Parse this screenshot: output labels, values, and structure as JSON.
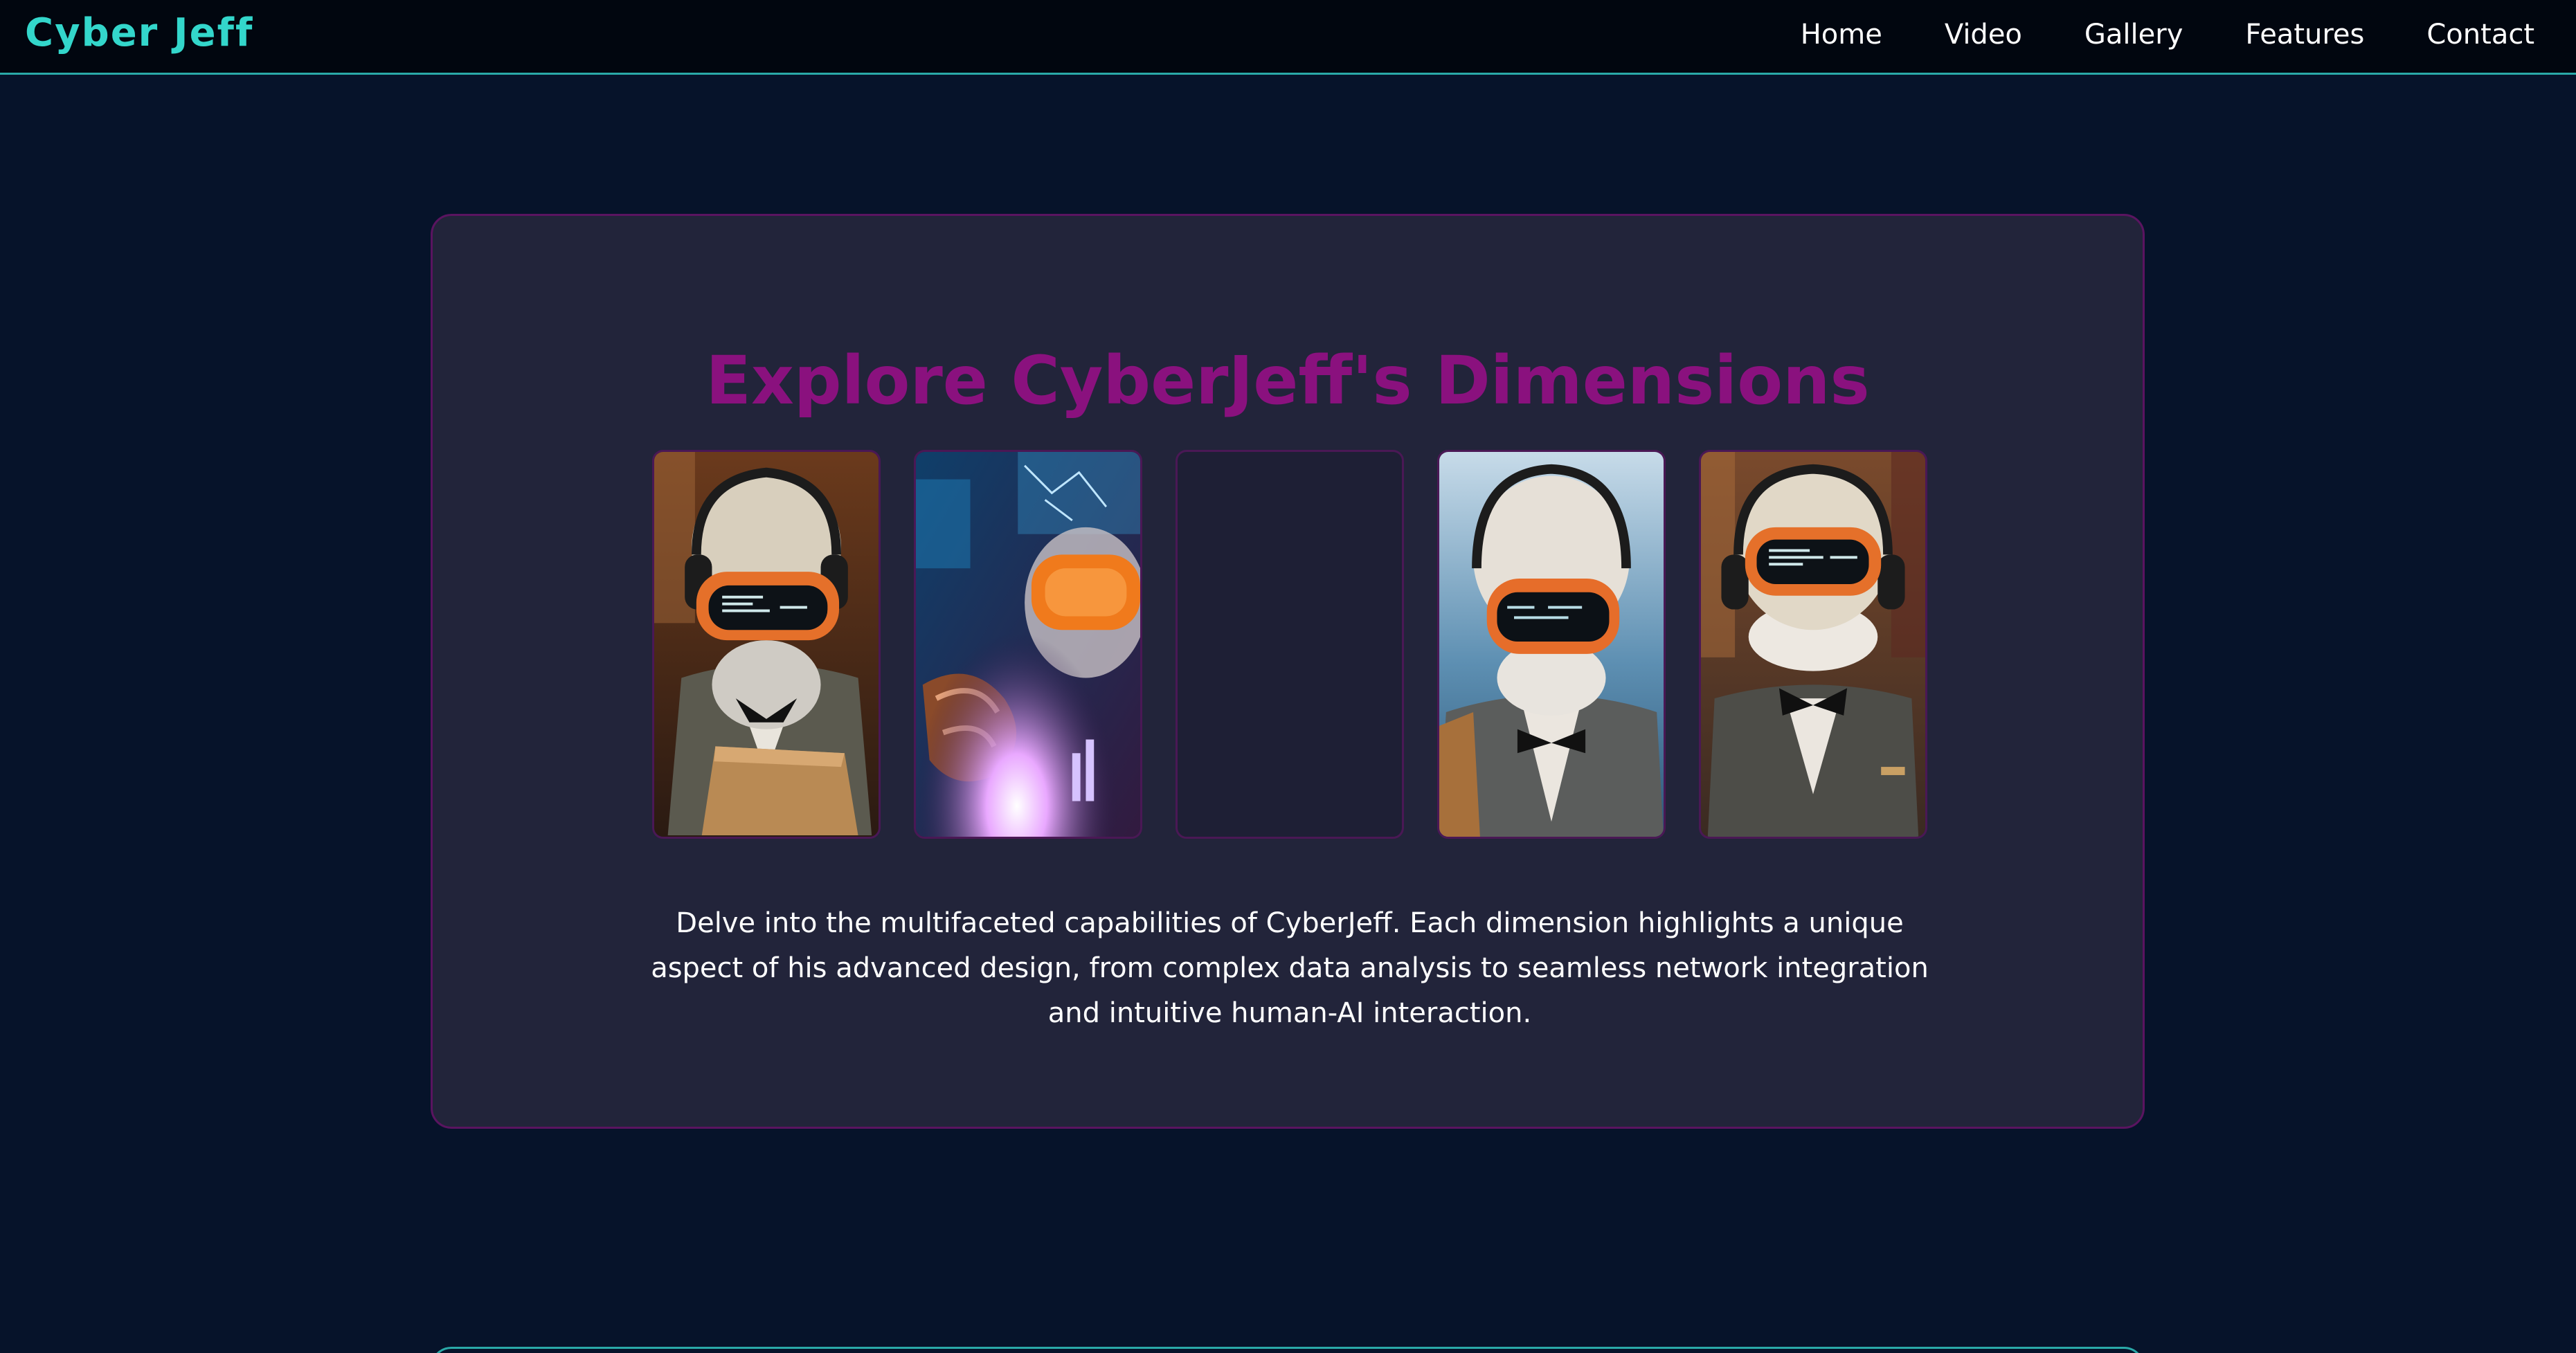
{
  "header": {
    "logo": "Cyber Jeff",
    "nav": [
      "Home",
      "Video",
      "Gallery",
      "Features",
      "Contact"
    ]
  },
  "dimensions": {
    "title": "Explore CyberJeff's Dimensions",
    "images": [
      "robot-portrait-holding-folder",
      "robot-hand-lab-closeup",
      "empty-placeholder",
      "robot-portrait-ocean-background",
      "robot-portrait-library"
    ],
    "description": "Delve into the multifaceted capabilities of CyberJeff. Each dimension highlights a unique aspect of his advanced design, from complex data analysis to seamless network integration and intuitive human-AI interaction."
  },
  "colors": {
    "background": "#06132a",
    "nav_background": "#01060f",
    "accent_teal": "#33d6cb",
    "title_magenta": "#8a117e",
    "card_background": "#22243a",
    "card_border": "#5a1460"
  }
}
